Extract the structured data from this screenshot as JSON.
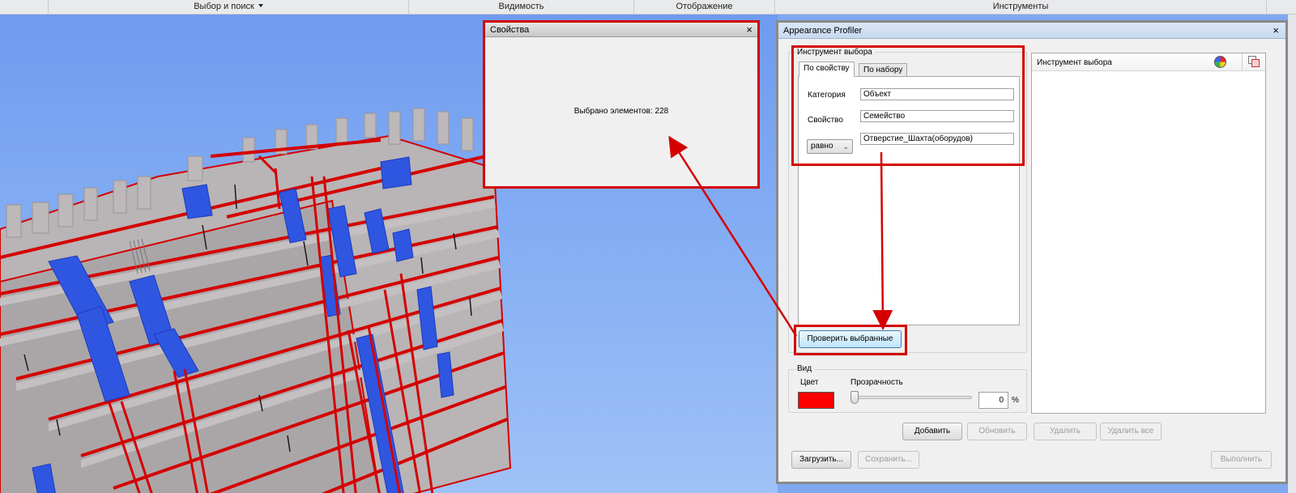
{
  "ribbon": {
    "sections": [
      "Выбор и поиск",
      "Видимость",
      "Отображение",
      "Инструменты"
    ]
  },
  "properties_window": {
    "title": "Свойства",
    "close": "×",
    "selected_text": "Выбрано элементов: 228"
  },
  "appearance_profiler": {
    "title": "Appearance Profiler",
    "close": "×",
    "selector_group": {
      "label": "Инструмент выбора",
      "tabs": [
        "По свойству",
        "По набору"
      ],
      "active_tab": "По свойству",
      "category_label": "Категория",
      "category_value": "Объект",
      "property_label": "Свойство",
      "property_value": "Семейство",
      "operator": "равно",
      "value": "Отверстие_Шахта(оборудов)",
      "test_button": "Проверить выбранные"
    },
    "view_group": {
      "label": "Вид",
      "color_label": "Цвет",
      "color": "#ff0000",
      "transparency_label": "Прозрачность",
      "transparency_value": "0",
      "transparency_unit": "%",
      "transparency_level": 0
    },
    "list": {
      "header": "Инструмент выбора"
    },
    "buttons": {
      "add": "Добавить",
      "update": "Обновить",
      "delete": "Удалить",
      "delete_all": "Удалить все",
      "load": "Загрузить...",
      "save": "Сохранить...",
      "run": "Выполнить"
    }
  },
  "colors": {
    "highlight_red": "#d40000",
    "element_blue": "#2f56e0",
    "building_grey": "#b9b4b6"
  }
}
